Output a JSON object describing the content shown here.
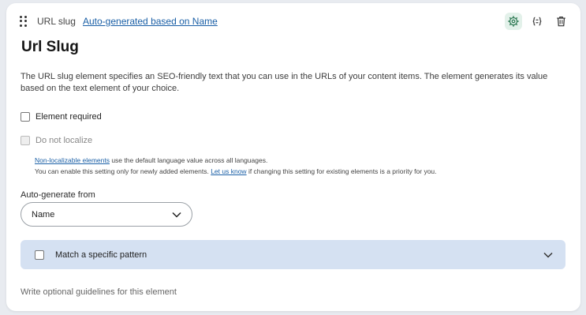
{
  "header": {
    "type_label": "URL slug",
    "auto_link": "Auto-generated based on Name"
  },
  "icons": {
    "drag": "drag-handle-icon",
    "settings": "gear-icon",
    "code": "code-braces-icon",
    "delete": "trash-icon"
  },
  "title": "Url Slug",
  "description": "The URL slug element specifies an SEO-friendly text that you can use in the URLs of your content items. The element generates its value based on the text element of your choice.",
  "options": {
    "required_label": "Element required",
    "localize_label": "Do not localize"
  },
  "note": {
    "line1_link": "Non-localizable elements",
    "line1_text": " use the default language value across all languages.",
    "line2_pre": "You can enable this setting only for newly added elements. ",
    "line2_link": "Let us know",
    "line2_post": " if changing this setting for existing elements is a priority for you."
  },
  "auto_generate": {
    "label": "Auto-generate from",
    "selected": "Name"
  },
  "pattern": {
    "label": "Match a specific pattern"
  },
  "guidelines_placeholder": "Write optional guidelines for this element",
  "colors": {
    "link": "#1a5fa6",
    "pattern_bg": "#d5e1f2",
    "settings_active_bg": "#e3f1ea"
  }
}
